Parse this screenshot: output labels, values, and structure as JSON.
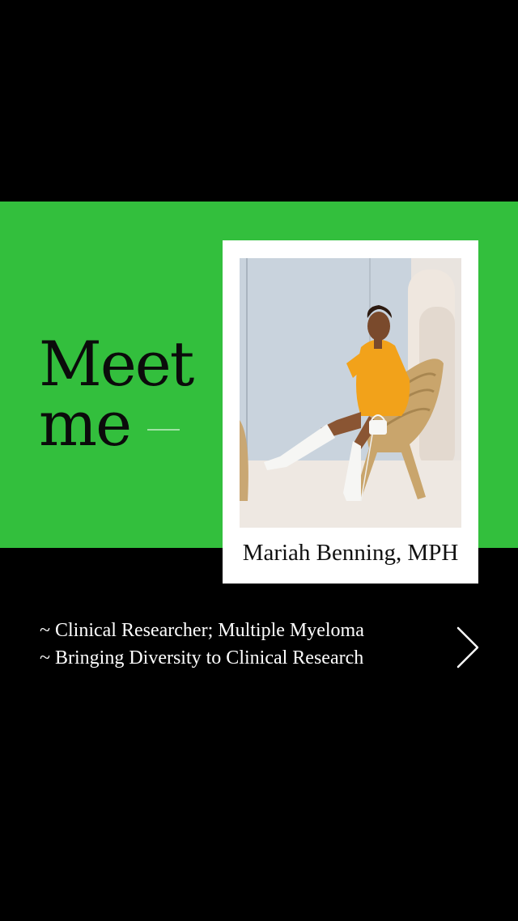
{
  "headline": {
    "line1": "Meet",
    "line2": "me"
  },
  "profile": {
    "name": "Mariah Benning, MPH",
    "photo_icon": "portrait-photo-icon"
  },
  "bullets": [
    "~ Clinical Researcher; Multiple Myeloma",
    "~ Bringing Diversity to Clinical Research"
  ],
  "navigation": {
    "next_icon": "chevron-right-icon"
  },
  "colors": {
    "background": "#000000",
    "accent_green": "#33bf3d",
    "card": "#ffffff",
    "outfit": "#f2a21a"
  }
}
